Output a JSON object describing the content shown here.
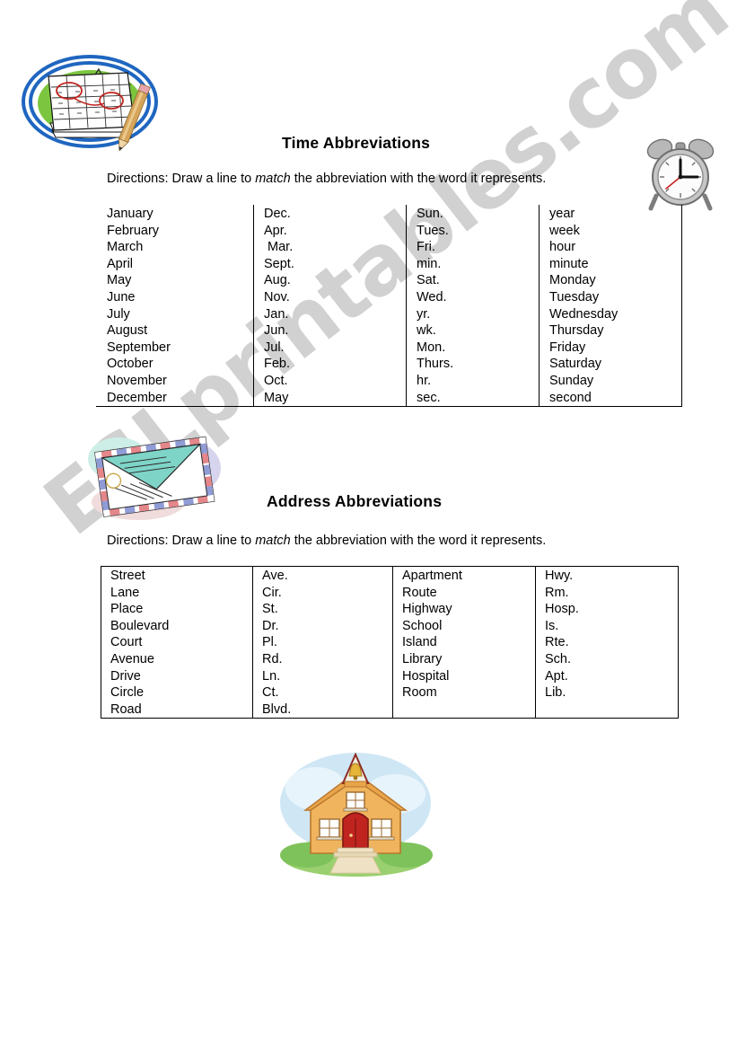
{
  "watermark": {
    "text": "ESLprintables.com"
  },
  "sections": [
    {
      "id": "time",
      "title": "Time Abbreviations",
      "directions_before": "Directions: Draw a line to ",
      "directions_emphasis": "match",
      "directions_after": " the abbreviation with the word it represents.",
      "columns": [
        {
          "name": "months-full",
          "items": [
            "January",
            "February",
            "March",
            "April",
            "May",
            "June",
            "July",
            "August",
            "September",
            "October",
            "November",
            "December"
          ]
        },
        {
          "name": "months-abbrev",
          "items": [
            "Dec.",
            "Apr.",
            " Mar.",
            "Sept.",
            "Aug.",
            "Nov.",
            "Jan.",
            "Jun.",
            "Jul.",
            "Feb.",
            "Oct.",
            "May"
          ]
        },
        {
          "name": "time-abbrev",
          "items": [
            "Sun.",
            "Tues.",
            "Fri.",
            "min.",
            "Sat.",
            "Wed.",
            "yr.",
            "wk.",
            "Mon.",
            "Thurs.",
            "hr.",
            "sec."
          ]
        },
        {
          "name": "time-full",
          "items": [
            "year",
            "week",
            "hour",
            "minute",
            "Monday",
            "Tuesday",
            "Wednesday",
            "Thursday",
            "Friday",
            "Saturday",
            "Sunday",
            "second"
          ]
        }
      ]
    },
    {
      "id": "address",
      "title": "Address Abbreviations",
      "directions_before": "Directions: Draw a line to ",
      "directions_emphasis": "match",
      "directions_after": " the abbreviation with the word it represents.",
      "columns": [
        {
          "name": "address-words-left",
          "items": [
            "Street",
            "Lane",
            "Place",
            "Boulevard",
            "Court",
            "Avenue",
            "Drive",
            "Circle",
            "Road"
          ]
        },
        {
          "name": "address-abbrev-left",
          "items": [
            "Ave.",
            "Cir.",
            "St.",
            "Dr.",
            "Pl.",
            "Rd.",
            "Ln.",
            "Ct.",
            "Blvd."
          ]
        },
        {
          "name": "address-words-right",
          "items": [
            "Apartment",
            "Route",
            "Highway",
            "School",
            "Island",
            "Library",
            "Hospital",
            "Room"
          ]
        },
        {
          "name": "address-abbrev-right",
          "items": [
            "Hwy.",
            "Rm.",
            "Hosp.",
            "Is.",
            "Rte.",
            "Sch.",
            "Apt.",
            "Lib."
          ]
        }
      ]
    }
  ],
  "illustrations": [
    {
      "name": "calendar-with-pencil-image",
      "alt": "calendar with pencil"
    },
    {
      "name": "alarm-clock-image",
      "alt": "alarm clock"
    },
    {
      "name": "airmail-envelope-image",
      "alt": "airmail envelope"
    },
    {
      "name": "schoolhouse-image",
      "alt": "schoolhouse"
    }
  ],
  "colors": {
    "ink": "#000000",
    "paper": "#ffffff",
    "watermark": "#c9c9c9",
    "calendar_blue": "#1f66c0",
    "calendar_green": "#7cc63f",
    "clock_grey": "#9a9a9a",
    "clock_red": "#cc2020",
    "envelope_teal": "#7fd4c8",
    "school_wall": "#f0b45e",
    "school_door": "#c0241f",
    "school_sky": "#bfe0f2",
    "school_grass": "#8ec96b"
  }
}
